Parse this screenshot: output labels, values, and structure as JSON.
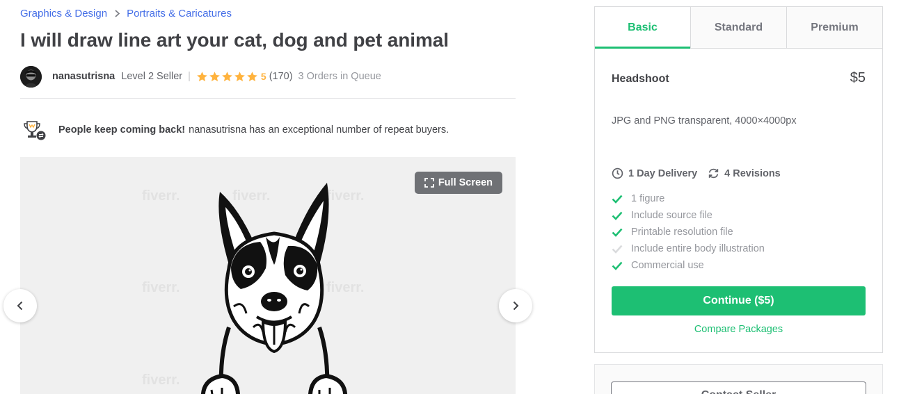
{
  "breadcrumb": {
    "items": [
      "Graphics & Design",
      "Portraits & Caricatures"
    ]
  },
  "gig": {
    "title": "I will draw line art your cat, dog and pet animal"
  },
  "seller": {
    "name": "nanasutrisna",
    "level": "Level 2 Seller",
    "separator": "|",
    "rating": "5",
    "rating_value": 5,
    "stars": 5,
    "rating_count": "(170)",
    "queue": "3 Orders in Queue"
  },
  "repeat_buyers": {
    "bold": "People keep coming back!",
    "text": "nanasutrisna has an exceptional number of repeat buyers."
  },
  "gallery": {
    "fullscreen_label": "Full Screen",
    "watermark": "fiverr."
  },
  "packages": {
    "tabs": [
      "Basic",
      "Standard",
      "Premium"
    ],
    "active_tab": "Basic",
    "name": "Headshoot",
    "price": "$5",
    "description": "JPG and PNG transparent, 4000×4000px",
    "delivery": "1 Day Delivery",
    "revisions": "4 Revisions",
    "features": [
      {
        "label": "1 figure",
        "included": true
      },
      {
        "label": "Include source file",
        "included": true
      },
      {
        "label": "Printable resolution file",
        "included": true
      },
      {
        "label": "Include entire body illustration",
        "included": false
      },
      {
        "label": "Commercial use",
        "included": true
      }
    ],
    "continue_label": "Continue ($5)",
    "compare_label": "Compare Packages"
  },
  "contact": {
    "label": "Contact Seller"
  },
  "colors": {
    "accent": "#1dbf73",
    "link": "#446ee7",
    "star": "#ffb33e",
    "feature_off": "#dadbdd"
  }
}
